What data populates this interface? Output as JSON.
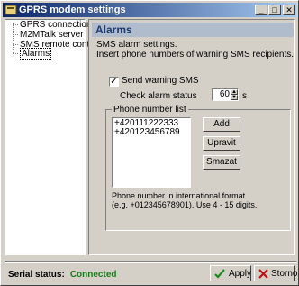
{
  "window": {
    "title": "GPRS modem settings",
    "min": "_",
    "max": "□",
    "close": "✕"
  },
  "tree": {
    "items": [
      "GPRS connection",
      "M2MTalk server",
      "SMS remote control",
      "Alarms"
    ]
  },
  "panel": {
    "title": "Alarms",
    "desc1": "SMS alarm settings.",
    "desc2": "Insert phone numbers of warning SMS recipients."
  },
  "alarm": {
    "send_warning_label": "Send warning SMS",
    "send_warning_checked": true,
    "check_status_label": "Check alarm status",
    "check_status_value": "60",
    "check_status_unit": "s"
  },
  "phones": {
    "group_label": "Phone number list",
    "numbers": [
      "+420111222333",
      "+420123456789"
    ],
    "add_label": "Add",
    "edit_label": "Upravit",
    "delete_label": "Smazat",
    "hint1": "Phone number in international format",
    "hint2": "(e.g. +012345678901). Use 4 - 15 digits."
  },
  "footer": {
    "status_label": "Serial status:",
    "status_value": "Connected",
    "apply_label": "Apply",
    "cancel_label": "Storno"
  }
}
